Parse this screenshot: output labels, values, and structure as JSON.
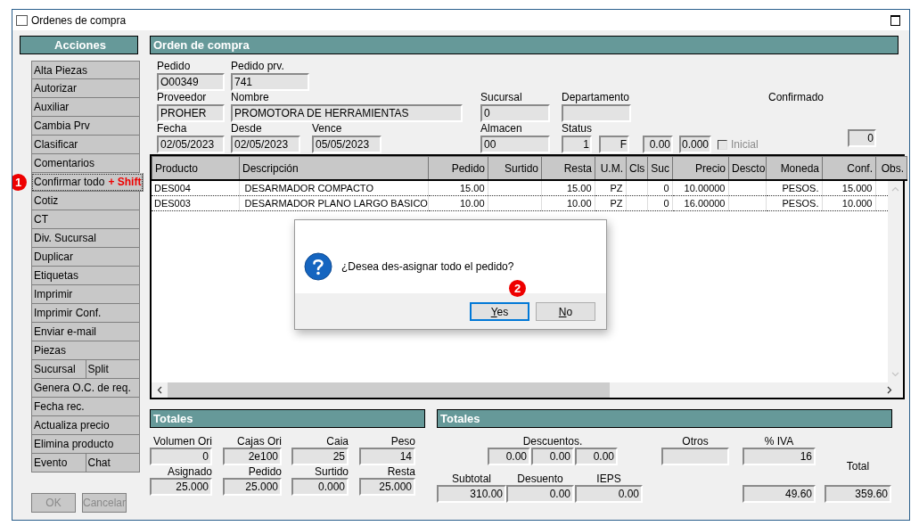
{
  "window": {
    "title": "Ordenes de compra"
  },
  "actions": {
    "title": "Acciones",
    "rows": [
      [
        {
          "label": "Alta Piezas",
          "focused": false
        }
      ],
      [
        {
          "label": "Autorizar",
          "focused": false
        }
      ],
      [
        {
          "label": "Auxiliar",
          "focused": false
        }
      ],
      [
        {
          "label": "Cambia Prv",
          "focused": false
        }
      ],
      [
        {
          "label": "Clasificar",
          "focused": false
        }
      ],
      [
        {
          "label": "Comentarios",
          "focused": false
        }
      ],
      [
        {
          "label": "Confirmar todo",
          "focused": true,
          "badge": "1",
          "note": "+ Shift"
        }
      ],
      [
        {
          "label": "Cotiz",
          "focused": false
        }
      ],
      [
        {
          "label": "CT",
          "focused": false
        }
      ],
      [
        {
          "label": "Div. Sucursal",
          "focused": false
        }
      ],
      [
        {
          "label": "Duplicar",
          "focused": false
        }
      ],
      [
        {
          "label": "Etiquetas",
          "focused": false
        }
      ],
      [
        {
          "label": "Imprimir",
          "focused": false
        }
      ],
      [
        {
          "label": "Imprimir Conf.",
          "focused": false
        }
      ],
      [
        {
          "label": "Enviar e-mail",
          "focused": false
        }
      ],
      [
        {
          "label": "Piezas",
          "focused": false
        }
      ],
      [
        {
          "label": "Sucursal",
          "focused": false
        },
        {
          "label": "Split",
          "focused": false
        }
      ],
      [
        {
          "label": "Genera O.C. de req.",
          "focused": false
        }
      ],
      [
        {
          "label": "Fecha rec.",
          "focused": false
        }
      ],
      [
        {
          "label": "Actualiza precio",
          "focused": false
        }
      ],
      [
        {
          "label": "Elimina producto",
          "focused": false
        }
      ],
      [
        {
          "label": "Evento",
          "focused": false
        },
        {
          "label": "Chat",
          "focused": false
        }
      ]
    ],
    "footer_buttons": [
      {
        "label": "OK",
        "disabled": true
      },
      {
        "label": "Cancelar",
        "disabled": true
      }
    ]
  },
  "order": {
    "title": "Orden de compra",
    "pedido": {
      "label": "Pedido",
      "value": "O00349"
    },
    "pedido_prv": {
      "label": "Pedido prv.",
      "value": "741"
    },
    "proveedor": {
      "label": "Proveedor",
      "value": "PROHER"
    },
    "nombre": {
      "label": "Nombre",
      "value": "PROMOTORA DE HERRAMIENTAS"
    },
    "sucursal": {
      "label": "Sucursal",
      "value": "0"
    },
    "departamento": {
      "label": "Departamento"
    },
    "confirmado": {
      "label": "Confirmado",
      "value": "0"
    },
    "fecha": {
      "label": "Fecha",
      "value": "02/05/2023"
    },
    "desde": {
      "label": "Desde",
      "value": "02/05/2023"
    },
    "vence": {
      "label": "Vence",
      "value": "05/05/2023"
    },
    "almacen": {
      "label": "Almacen",
      "value": "00"
    },
    "status": {
      "label": "Status",
      "values": [
        "1",
        "F"
      ]
    },
    "amounts": [
      "0.00",
      "0.000"
    ],
    "inicial": {
      "label": "Inicial",
      "checked": false,
      "disabled": true
    }
  },
  "table": {
    "columns": [
      "Producto",
      "Descripción",
      "Pedido",
      "Surtido",
      "Resta",
      "U.M.",
      "Cls",
      "Suc",
      "Precio",
      "Descto",
      "Moneda",
      "Conf.",
      "Obs."
    ],
    "rows": [
      {
        "cells": [
          "DES004",
          "DESARMADOR COMPACTO",
          "15.00",
          null,
          "15.00",
          "PZ",
          null,
          "0",
          "10.00000",
          null,
          "PESOS.",
          "15.000",
          null
        ]
      },
      {
        "cells": [
          "DES003",
          "DESARMADOR PLANO LARGO BASICO",
          "10.00",
          null,
          "10.00",
          "PZ",
          null,
          "0",
          "16.00000",
          null,
          "PESOS.",
          "10.000",
          null
        ]
      }
    ]
  },
  "dialog": {
    "message": "¿Desea des-asignar todo el pedido?",
    "buttons": [
      {
        "label": "Yes",
        "default": true,
        "badge": "2"
      },
      {
        "label": "No",
        "default": false
      }
    ]
  },
  "totals_left": {
    "title": "Totales",
    "fields": [
      {
        "label": "Volumen Ori",
        "value": "0"
      },
      {
        "label": "Cajas Ori",
        "value": "2e100"
      },
      {
        "label": "Caia",
        "value": "25"
      },
      {
        "label": "Peso",
        "value": "14"
      },
      {
        "label": "Asignado",
        "value": "25.000"
      },
      {
        "label": "Pedido",
        "value": "25.000"
      },
      {
        "label": "Surtido",
        "value": "0.000"
      },
      {
        "label": "Resta",
        "value": "25.000"
      }
    ]
  },
  "totals_right": {
    "title": "Totales",
    "descuentos": {
      "label": "Descuentos.",
      "values": [
        "0.00",
        "0.00",
        "0.00"
      ]
    },
    "otros": {
      "label": "Otros"
    },
    "iva": {
      "label": "% IVA",
      "value": "16"
    },
    "total_label": "Total",
    "bottom": [
      {
        "label": "Subtotal",
        "value": "310.00"
      },
      {
        "label": "Desuento",
        "value": "0.00"
      },
      {
        "label": "IEPS",
        "value": "0.00"
      },
      {
        "value": "49.60"
      },
      {
        "value": "359.60"
      }
    ]
  }
}
